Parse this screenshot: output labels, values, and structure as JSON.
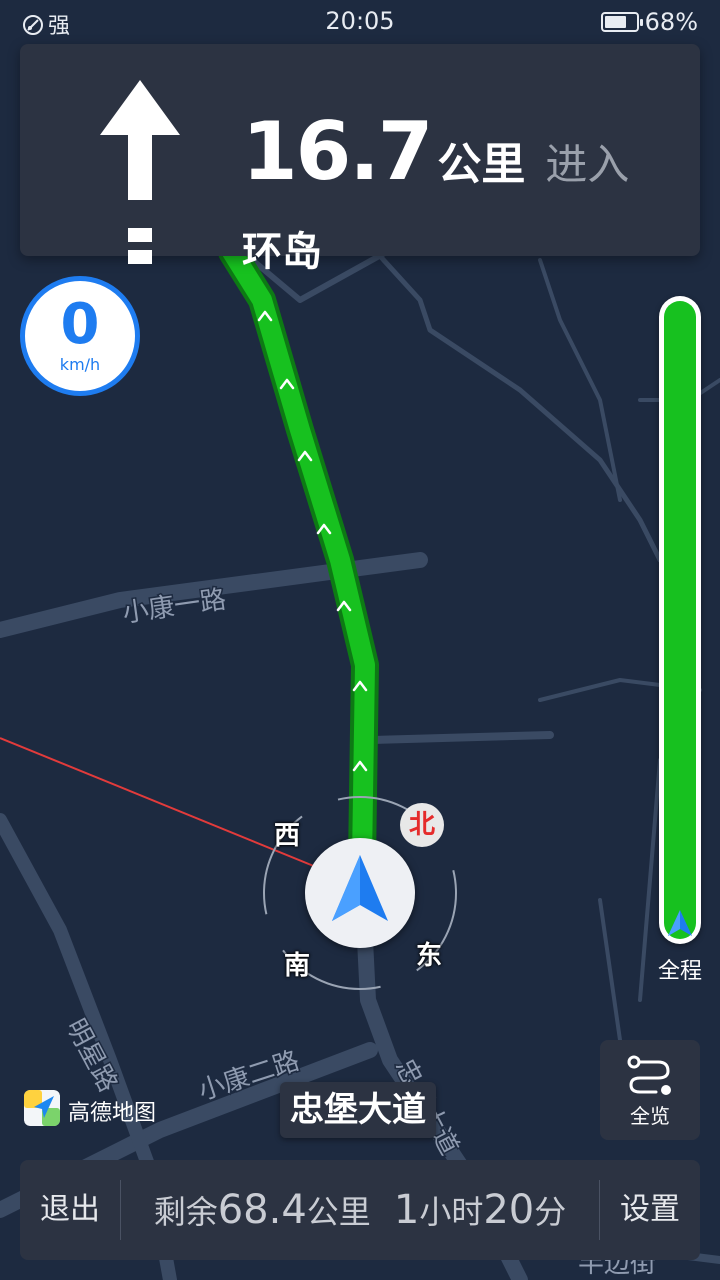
{
  "status_bar": {
    "signal": "强",
    "time": "20:05",
    "battery": "68%"
  },
  "guidance": {
    "distance": "16.7",
    "distance_unit": "公里",
    "action": "进入",
    "next_road": "环岛",
    "maneuver_icon": "straight-arrow-icon"
  },
  "speedometer": {
    "value": "0",
    "unit": "km/h"
  },
  "map": {
    "road_labels": [
      "小康一路",
      "小康二路",
      "明星路",
      "忠堡大道",
      "半边街"
    ],
    "current_road": "忠堡大道",
    "route_color": "#17c11f",
    "background_color": "#1d2a40"
  },
  "compass": {
    "west": "西",
    "north": "北",
    "south": "南",
    "east": "东"
  },
  "route_progress": {
    "label": "全程",
    "remaining_fraction": 1.0
  },
  "overview_button": {
    "label": "全览",
    "icon": "route-icon"
  },
  "logo": {
    "text": "高德地图"
  },
  "bottom_bar": {
    "exit_label": "退出",
    "remaining_prefix": "剩余",
    "remaining_distance": "68.4",
    "remaining_distance_unit": "公里",
    "hours": "1",
    "hours_unit": "小时",
    "minutes": "20",
    "minutes_unit": "分",
    "settings_label": "设置"
  }
}
